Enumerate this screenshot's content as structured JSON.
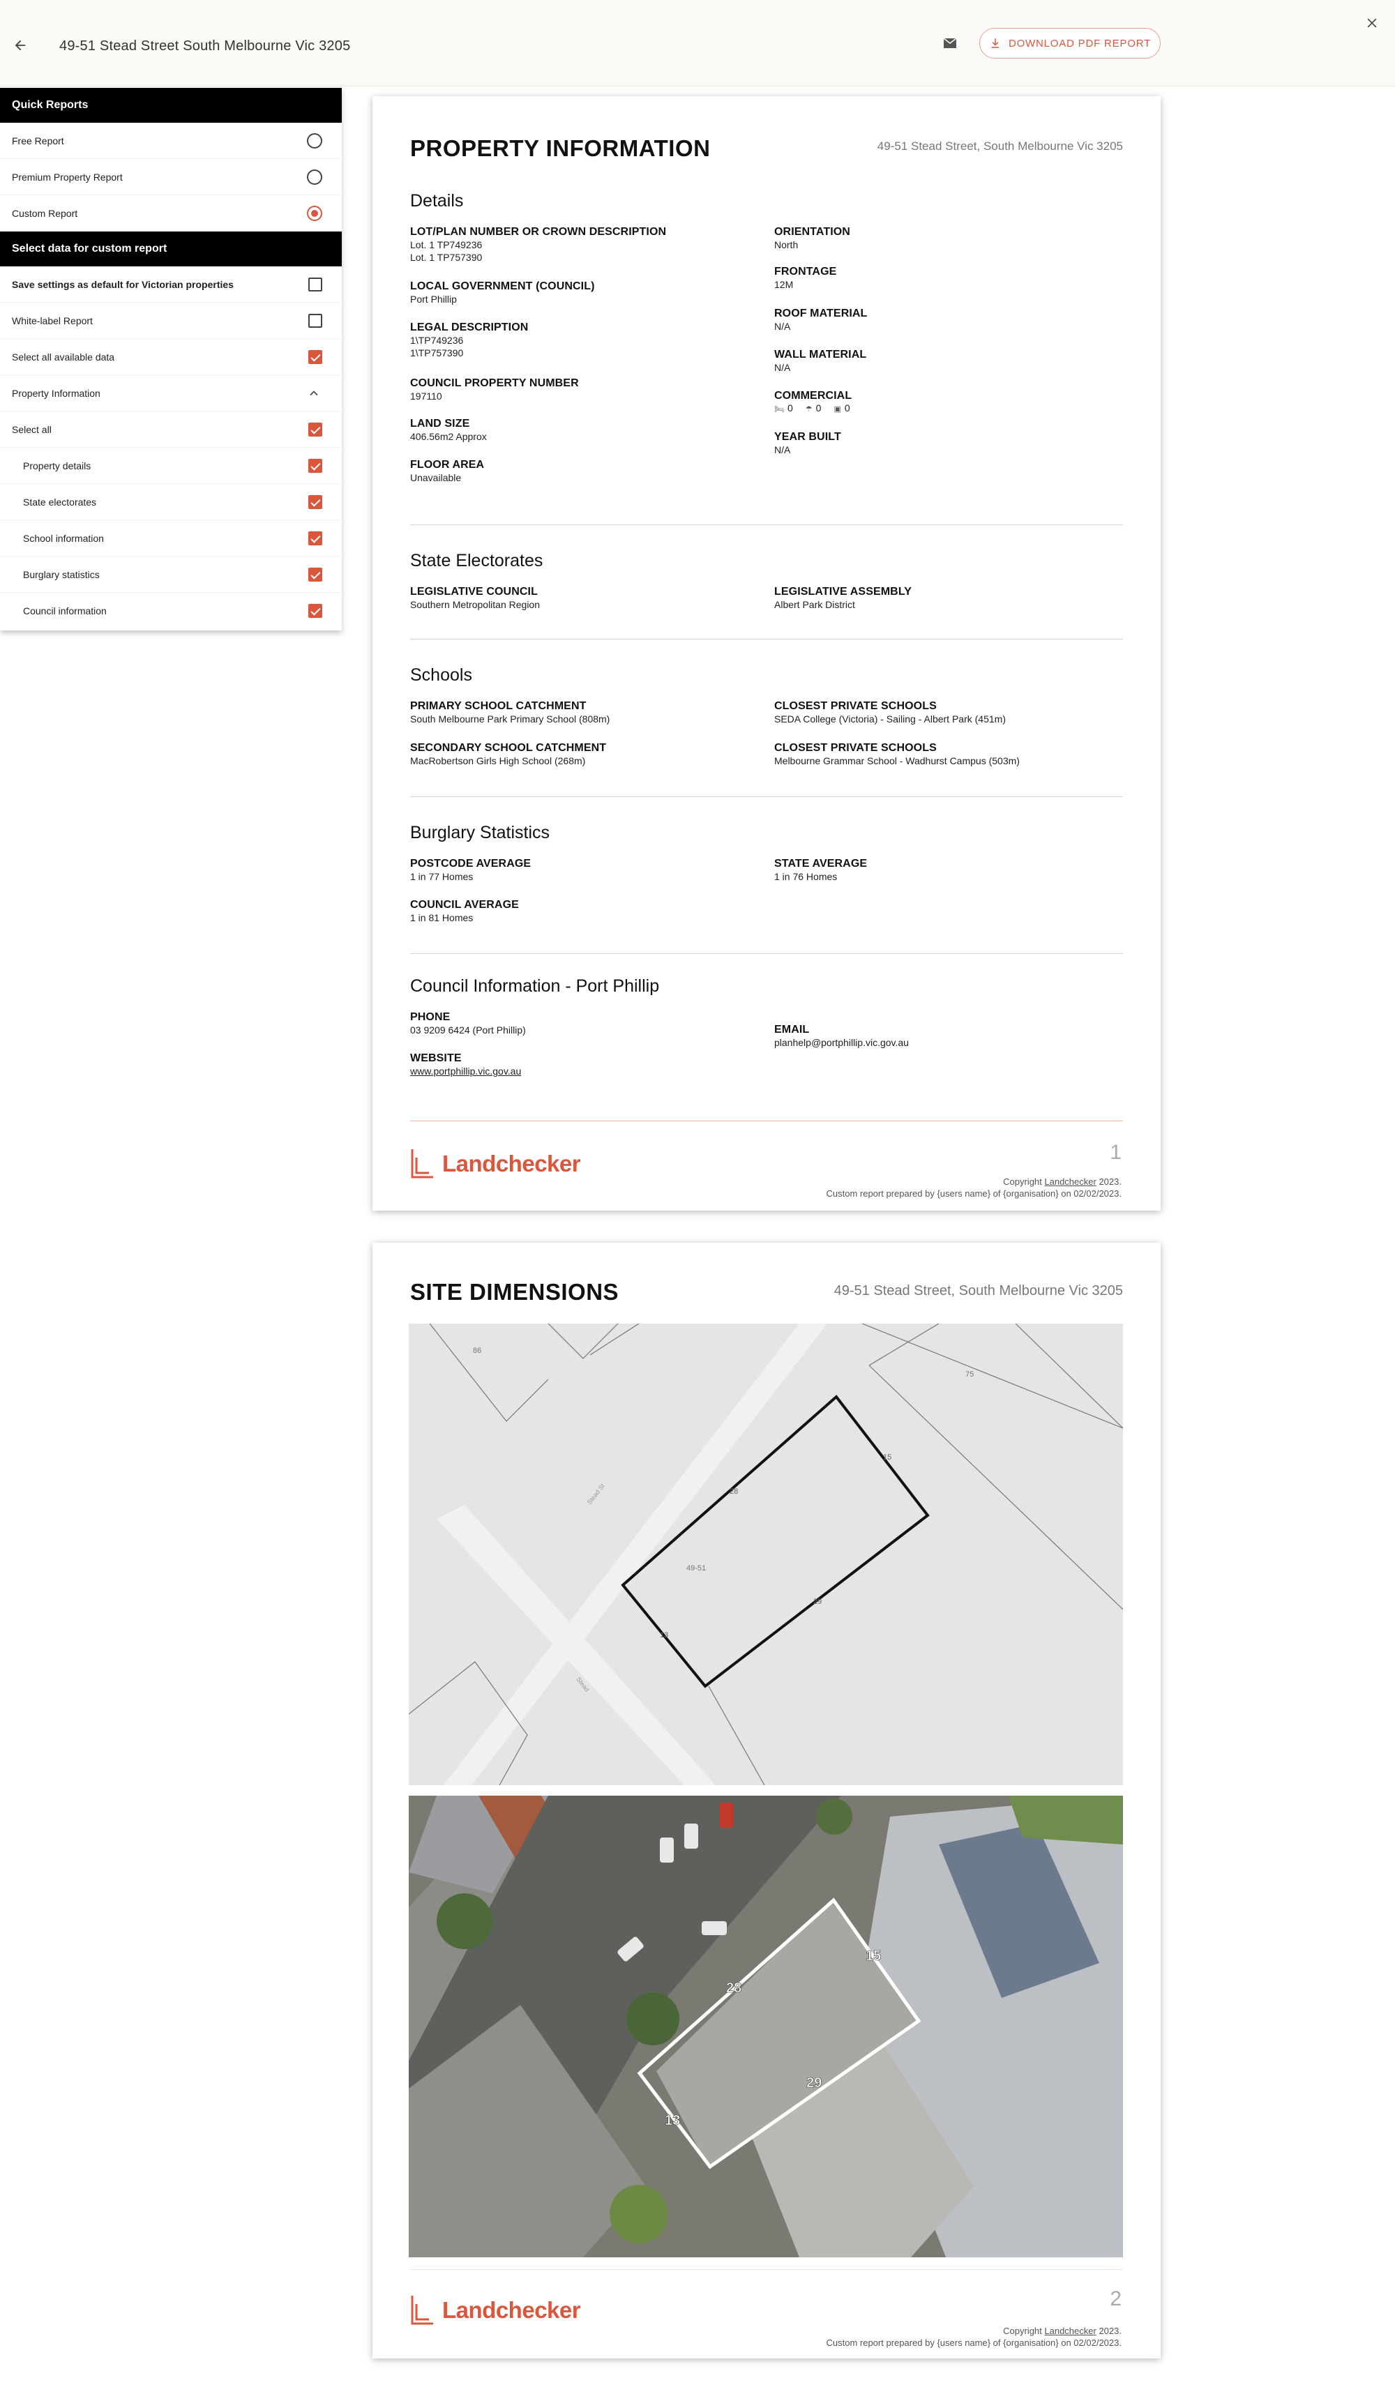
{
  "topbar": {
    "title": "49-51 Stead Street South Melbourne Vic 3205",
    "download_label": "DOWNLOAD PDF REPORT",
    "icons": {
      "back": "arrow-left-icon",
      "mail": "mail-icon",
      "download": "download-icon",
      "close": "close-icon"
    }
  },
  "sidebar": {
    "quick_reports_header": "Quick Reports",
    "reports": [
      {
        "label": "Free Report",
        "selected": false
      },
      {
        "label": "Premium Property Report",
        "selected": false
      },
      {
        "label": "Custom Report",
        "selected": true
      }
    ],
    "custom_header": "Select data for custom report",
    "options": [
      {
        "label": "Save settings as default for Victorian properties",
        "checked": false
      },
      {
        "label": "White-label Report",
        "checked": false
      },
      {
        "label": "Select all available data",
        "checked": true
      }
    ],
    "group_label": "Property Information",
    "group_items": [
      {
        "label": "Select all",
        "checked": true
      },
      {
        "label": "Property details",
        "checked": true
      },
      {
        "label": "State electorates",
        "checked": true
      },
      {
        "label": "School information",
        "checked": true
      },
      {
        "label": "Burglary statistics",
        "checked": true
      },
      {
        "label": "Council information",
        "checked": true
      }
    ]
  },
  "page1": {
    "title": "PROPERTY INFORMATION",
    "address": "49-51 Stead Street, South Melbourne Vic 3205",
    "details": {
      "heading": "Details",
      "lot_label": "LOT/PLAN NUMBER OR CROWN DESCRIPTION",
      "lot_value_1": "Lot. 1 TP749236",
      "lot_value_2": "Lot. 1 TP757390",
      "council_label": "LOCAL GOVERNMENT (COUNCIL)",
      "council_value": "Port Phillip",
      "legal_label": "LEGAL DESCRIPTION",
      "legal_value_1": "1\\TP749236",
      "legal_value_2": "1\\TP757390",
      "cpn_label": "COUNCIL PROPERTY NUMBER",
      "cpn_value": "197110",
      "land_label": "LAND SIZE",
      "land_value": "406.56m2 Approx",
      "floor_label": "FLOOR AREA",
      "floor_value": "Unavailable",
      "orientation_label": "ORIENTATION",
      "orientation_value": "North",
      "frontage_label": "FRONTAGE",
      "frontage_value": "12M",
      "roof_label": "ROOF MATERIAL",
      "roof_value": "N/A",
      "wall_label": "WALL MATERIAL",
      "wall_value": "N/A",
      "commercial_label": "COMMERCIAL",
      "commercial_values": [
        "0",
        "0",
        "0"
      ],
      "year_label": "YEAR BUILT",
      "year_value": "N/A"
    },
    "electorates": {
      "heading": "State Electorates",
      "lc_label": "LEGISLATIVE COUNCIL",
      "lc_value": "Southern Metropolitan Region",
      "la_label": "LEGISLATIVE ASSEMBLY",
      "la_value": "Albert Park District"
    },
    "schools": {
      "heading": "Schools",
      "primary_label": "PRIMARY SCHOOL CATCHMENT",
      "primary_value": "South Melbourne Park Primary School (808m)",
      "secondary_label": "SECONDARY SCHOOL CATCHMENT",
      "secondary_value": "MacRobertson Girls High School (268m)",
      "private1_label": "CLOSEST PRIVATE SCHOOLS",
      "private1_value": "SEDA College (Victoria) - Sailing - Albert Park (451m)",
      "private2_label": "CLOSEST PRIVATE SCHOOLS",
      "private2_value": "Melbourne Grammar School - Wadhurst Campus (503m)"
    },
    "burglary": {
      "heading": "Burglary Statistics",
      "postcode_label": "POSTCODE AVERAGE",
      "postcode_value": "1 in 77 Homes",
      "state_label": "STATE AVERAGE",
      "state_value": "1 in 76 Homes",
      "council_label": "COUNCIL AVERAGE",
      "council_value": "1 in 81 Homes"
    },
    "council": {
      "heading": "Council Information - Port Phillip",
      "phone_label": "PHONE",
      "phone_value": "03 9209 6424 (Port Phillip)",
      "email_label": "EMAIL",
      "email_value": "planhelp@portphillip.vic.gov.au",
      "website_label": "WEBSITE",
      "website_value": "www.portphillip.vic.gov.au"
    },
    "footer": {
      "logo_text": "Landchecker",
      "page_number": "1",
      "copyright_prefix": "Copyright ",
      "copyright_link": "Landchecker",
      "copyright_suffix": " 2023.",
      "prepared": "Custom report prepared by {users name} of {organisation} on 02/02/2023."
    }
  },
  "page2": {
    "title": "SITE DIMENSIONS",
    "address": "49-51 Stead Street, South Melbourne Vic 3205",
    "map_labels": {
      "lot": "49-51",
      "n1": "86",
      "n2": "75",
      "street1": "Stead St",
      "street2": "Stead"
    },
    "dimensions": {
      "a": "28",
      "b": "15",
      "c": "29",
      "d": "13"
    },
    "footer": {
      "logo_text": "Landchecker",
      "page_number": "2",
      "copyright_prefix": "Copyright ",
      "copyright_link": "Landchecker",
      "copyright_suffix": " 2023.",
      "prepared": "Custom report prepared by {users name} of {organisation} on 02/02/2023."
    }
  },
  "colors": {
    "accent": "#d9573d",
    "topbar_bg": "#fbfaf6",
    "sidebar_header": "#000000",
    "map_bg": "#e5e5e5"
  }
}
